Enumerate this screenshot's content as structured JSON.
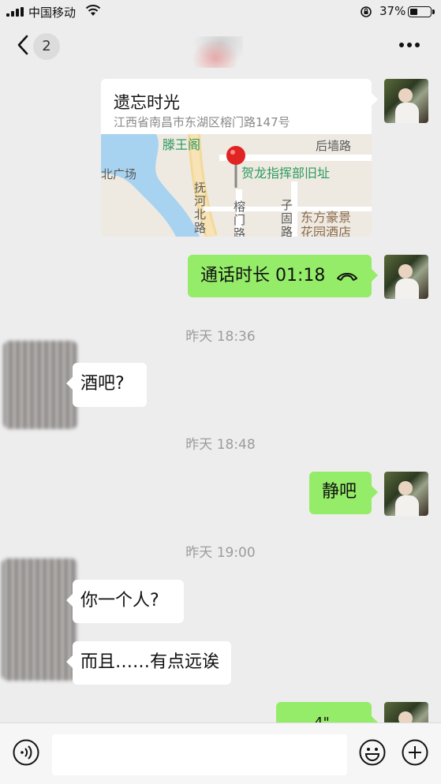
{
  "status_bar": {
    "carrier": "中国移动",
    "battery_percent": "37%",
    "battery_level": 0.37
  },
  "nav": {
    "back_badge_count": "2",
    "more_icon": "more-dots-icon"
  },
  "location_card": {
    "name": "遗忘时光",
    "address": "江西省南昌市东湖区榕门路147号",
    "map_labels": {
      "top_left": "滕王阁",
      "square": "北广场",
      "street_top": "后墙路",
      "landmark": "贺龙指挥部旧址",
      "road_fuhe": "抚河北路",
      "road_rongmen": "榕门路",
      "road_zigu": "子固路",
      "hotel_line1": "东方豪景",
      "hotel_line2": "花园酒店"
    }
  },
  "call_bubble": {
    "text": "通话时长 01:18"
  },
  "messages": {
    "ts1": "昨天 18:36",
    "m1": "酒吧?",
    "ts2": "昨天 18:48",
    "m2": "静吧",
    "ts3": "昨天 19:00",
    "m3": "你一个人?",
    "m4": "而且……有点远诶",
    "m5_partial": "4\""
  },
  "input_bar": {
    "placeholder": ""
  },
  "colors": {
    "background": "#ededed",
    "bubble_green": "#95ec69",
    "bubble_white": "#ffffff",
    "timestamp": "#9b9b9b"
  }
}
